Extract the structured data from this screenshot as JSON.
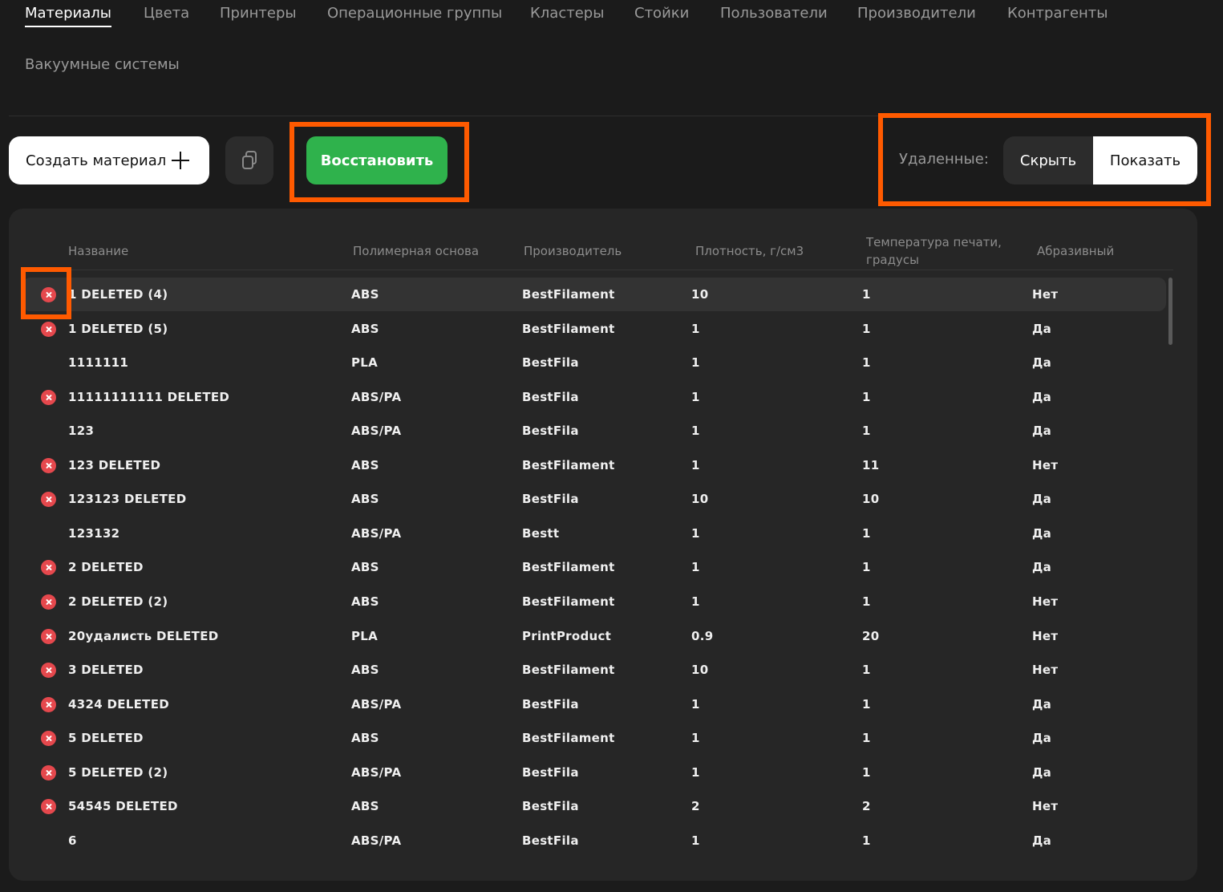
{
  "nav": {
    "tabs": [
      {
        "label": "Материалы",
        "active": true
      },
      {
        "label": "Цвета"
      },
      {
        "label": "Принтеры"
      },
      {
        "label": "Операционные группы"
      },
      {
        "label": "Кластеры"
      },
      {
        "label": "Стойки"
      },
      {
        "label": "Пользователи"
      },
      {
        "label": "Производители"
      },
      {
        "label": "Контрагенты"
      },
      {
        "label": "Вакуумные системы"
      }
    ]
  },
  "toolbar": {
    "create_label": "Создать материал",
    "create_icon": "plus-icon",
    "copy_icon": "copy-icon",
    "restore_label": "Восстановить",
    "deleted_label": "Удаленные:",
    "hide_label": "Скрыть",
    "show_label": "Показать",
    "selected_option": "Показать"
  },
  "colors": {
    "accent_green": "#2fb24c",
    "highlight_orange": "#ff5a00",
    "deleted_red": "#e5484d"
  },
  "table": {
    "columns": [
      "Название",
      "Полимерная основа",
      "Производитель",
      "Плотность, г/см3",
      "Температура печати, градусы",
      "Абразивный"
    ],
    "rows": [
      {
        "deleted": true,
        "selected": true,
        "name": "1 DELETED (4)",
        "base": "ABS",
        "maker": "BestFilament",
        "density": "10",
        "temp": "1",
        "abrasive": "Нет"
      },
      {
        "deleted": true,
        "name": "1 DELETED (5)",
        "base": "ABS",
        "maker": "BestFilament",
        "density": "1",
        "temp": "1",
        "abrasive": "Да"
      },
      {
        "deleted": false,
        "name": "1111111",
        "base": "PLA",
        "maker": "BestFila",
        "density": "1",
        "temp": "1",
        "abrasive": "Да"
      },
      {
        "deleted": true,
        "name": "11111111111 DELETED",
        "base": "ABS/PA",
        "maker": "BestFila",
        "density": "1",
        "temp": "1",
        "abrasive": "Да"
      },
      {
        "deleted": false,
        "name": "123",
        "base": "ABS/PA",
        "maker": "BestFila",
        "density": "1",
        "temp": "1",
        "abrasive": "Да"
      },
      {
        "deleted": true,
        "name": "123 DELETED",
        "base": "ABS",
        "maker": "BestFilament",
        "density": "1",
        "temp": "11",
        "abrasive": "Нет"
      },
      {
        "deleted": true,
        "name": "123123 DELETED",
        "base": "ABS",
        "maker": "BestFila",
        "density": "10",
        "temp": "10",
        "abrasive": "Да"
      },
      {
        "deleted": false,
        "name": "123132",
        "base": "ABS/PA",
        "maker": "Bestt",
        "density": "1",
        "temp": "1",
        "abrasive": "Да"
      },
      {
        "deleted": true,
        "name": "2 DELETED",
        "base": "ABS",
        "maker": "BestFilament",
        "density": "1",
        "temp": "1",
        "abrasive": "Да"
      },
      {
        "deleted": true,
        "name": "2 DELETED (2)",
        "base": "ABS",
        "maker": "BestFilament",
        "density": "1",
        "temp": "1",
        "abrasive": "Нет"
      },
      {
        "deleted": true,
        "name": "20удалисть DELETED",
        "base": "PLA",
        "maker": "PrintProduct",
        "density": "0.9",
        "temp": "20",
        "abrasive": "Нет"
      },
      {
        "deleted": true,
        "name": "3 DELETED",
        "base": "ABS",
        "maker": "BestFilament",
        "density": "10",
        "temp": "1",
        "abrasive": "Нет"
      },
      {
        "deleted": true,
        "name": "4324 DELETED",
        "base": "ABS/PA",
        "maker": "BestFila",
        "density": "1",
        "temp": "1",
        "abrasive": "Да"
      },
      {
        "deleted": true,
        "name": "5 DELETED",
        "base": "ABS",
        "maker": "BestFilament",
        "density": "1",
        "temp": "1",
        "abrasive": "Да"
      },
      {
        "deleted": true,
        "name": "5 DELETED (2)",
        "base": "ABS/PA",
        "maker": "BestFila",
        "density": "1",
        "temp": "1",
        "abrasive": "Да"
      },
      {
        "deleted": true,
        "name": "54545 DELETED",
        "base": "ABS",
        "maker": "BestFila",
        "density": "2",
        "temp": "2",
        "abrasive": "Нет"
      },
      {
        "deleted": false,
        "name": "6",
        "base": "ABS/PA",
        "maker": "BestFila",
        "density": "1",
        "temp": "1",
        "abrasive": "Да"
      }
    ]
  }
}
